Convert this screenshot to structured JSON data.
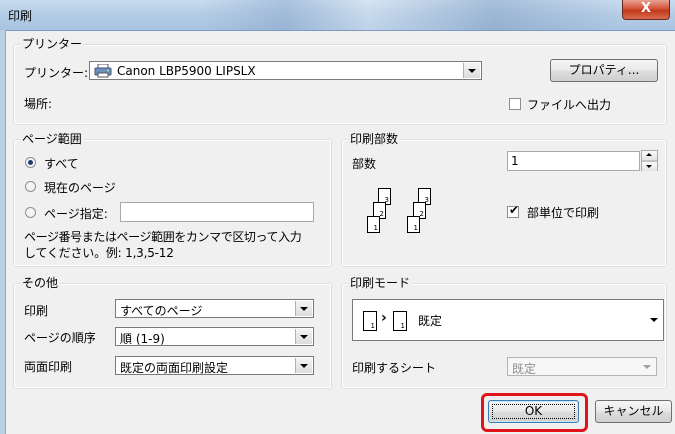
{
  "window": {
    "title": "印刷",
    "close_glyph": "X"
  },
  "printer": {
    "group_label": "プリンター",
    "name_label": "プリンター:",
    "selected_printer": "Canon LBP5900 LIPSLX",
    "properties_button": "プロパティ...",
    "location_label": "場所:",
    "print_to_file_label": "ファイルへ出力",
    "print_to_file_checked": false
  },
  "page_range": {
    "group_label": "ページ範囲",
    "options": [
      {
        "label": "すべて",
        "checked": true
      },
      {
        "label": "現在のページ",
        "checked": false
      },
      {
        "label": "ページ指定:",
        "checked": false
      }
    ],
    "pages_value": "",
    "hint_line1": "ページ番号またはページ範囲をカンマで区切って入力",
    "hint_line2": "してください。例: 1,3,5-12"
  },
  "copies": {
    "group_label": "印刷部数",
    "count_label": "部数",
    "count_value": "1",
    "collate_label": "部単位で印刷",
    "collate_checked": true,
    "collate_page_numbers": [
      "3",
      "2",
      "1",
      "3",
      "2",
      "1"
    ]
  },
  "other": {
    "group_label": "その他",
    "print_label": "印刷",
    "print_value": "すべてのページ",
    "order_label": "ページの順序",
    "order_value": "順 (1-9)",
    "duplex_label": "両面印刷",
    "duplex_value": "既定の両面印刷設定"
  },
  "print_mode": {
    "group_label": "印刷モード",
    "mode_value": "既定",
    "mode_page_left": "1",
    "mode_page_right": "1",
    "mode_arrow": "›",
    "sheets_label": "印刷するシート",
    "sheets_value": "既定"
  },
  "buttons": {
    "ok": "OK",
    "cancel": "キャンセル"
  },
  "icons": {
    "printer": "printer-icon",
    "dropdown": "chevron-down-icon",
    "close": "close-icon"
  },
  "colors": {
    "highlight": "#e0141b",
    "title_bar": "#b5cde6"
  }
}
